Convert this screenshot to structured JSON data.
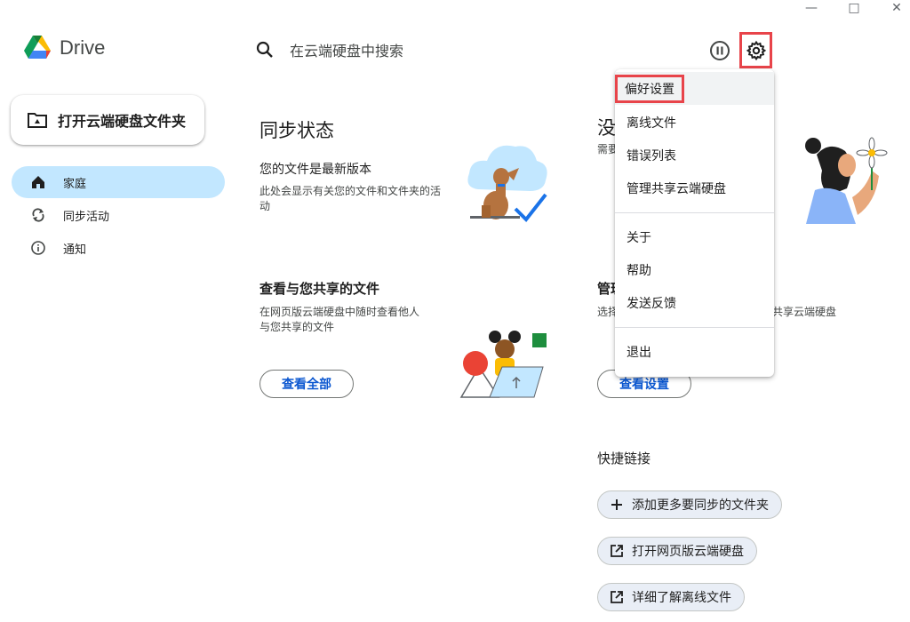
{
  "app": {
    "name": "Drive"
  },
  "window_controls": {
    "minimize": "—",
    "maximize": "□",
    "close": "✕"
  },
  "sidebar": {
    "open_folder_label": "打开云端硬盘文件夹",
    "items": [
      {
        "label": "家庭",
        "icon": "home-icon",
        "active": true
      },
      {
        "label": "同步活动",
        "icon": "sync-icon",
        "active": false
      },
      {
        "label": "通知",
        "icon": "info-icon",
        "active": false
      }
    ]
  },
  "search": {
    "placeholder": "在云端硬盘中搜索"
  },
  "sync_status": {
    "heading": "同步状态",
    "title": "您的文件是最新版本",
    "desc_line1": "此处会显示有关您的文件和文件夹的活",
    "desc_line2": "动"
  },
  "shared_files": {
    "title": "查看与您共享的文件",
    "desc_line1": "在网页版云端硬盘中随时查看他人",
    "desc_line2": "与您共享的文件",
    "button": "查看全部"
  },
  "offline_card": {
    "heading_partial": "没有",
    "desc_partial": "需要"
  },
  "manage_card": {
    "title_partial": "管理",
    "desc_left": "选择",
    "desc_right": "共享云端硬盘",
    "button": "查看设置"
  },
  "quick_links": {
    "heading": "快捷链接",
    "items": [
      {
        "label": "添加更多要同步的文件夹",
        "icon": "plus-icon"
      },
      {
        "label": "打开网页版云端硬盘",
        "icon": "open-external-icon"
      },
      {
        "label": "详细了解离线文件",
        "icon": "open-external-icon"
      }
    ]
  },
  "menu": {
    "group1": [
      "偏好设置",
      "离线文件",
      "错误列表",
      "管理共享云端硬盘"
    ],
    "group2": [
      "关于",
      "帮助",
      "发送反馈"
    ],
    "group3": [
      "退出"
    ]
  },
  "colors": {
    "accent": "#0b57d0",
    "active_nav": "#c2e7ff",
    "highlight": "#e8444a"
  }
}
